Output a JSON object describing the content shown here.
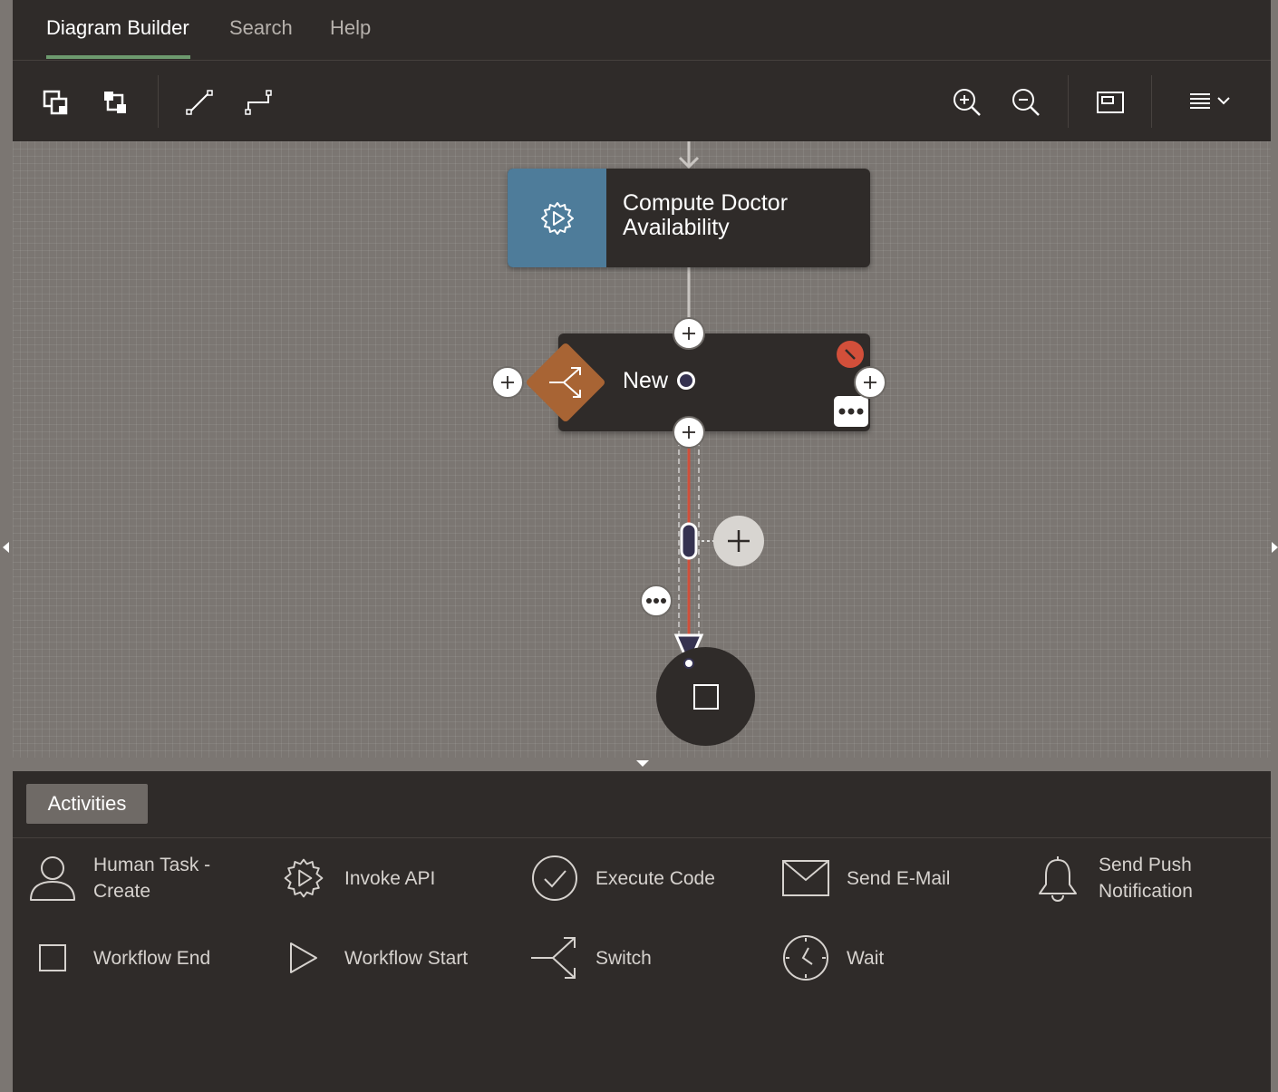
{
  "tabs": [
    {
      "label": "Diagram Builder",
      "active": true
    },
    {
      "label": "Search",
      "active": false
    },
    {
      "label": "Help",
      "active": false
    }
  ],
  "toolbar": {
    "left_icons": [
      "bring-to-front-icon",
      "send-to-back-icon",
      "straight-connector-icon",
      "elbow-connector-icon"
    ],
    "right_icons": [
      "zoom-in-icon",
      "zoom-out-icon",
      "fit-to-window-icon",
      "menu-icon"
    ]
  },
  "diagram": {
    "node1": {
      "label": "Compute Doctor Availability",
      "icon": "invoke-api-gear-icon",
      "color": "#4e7c9a"
    },
    "node2": {
      "label": "New",
      "icon": "switch-icon",
      "color": "#a86434",
      "status": "error"
    },
    "end_node": {
      "icon": "workflow-end-icon"
    },
    "connector_color": "#d24f3a"
  },
  "palette": {
    "tab_label": "Activities",
    "items": [
      {
        "label": "Human Task -\nCreate",
        "icon": "person-icon"
      },
      {
        "label": "Invoke API",
        "icon": "gear-play-icon"
      },
      {
        "label": "Execute Code",
        "icon": "check-circle-icon"
      },
      {
        "label": "Send E-Mail",
        "icon": "envelope-icon"
      },
      {
        "label": "Send Push\nNotification",
        "icon": "bell-icon"
      },
      {
        "label": "Workflow End",
        "icon": "square-icon"
      },
      {
        "label": "Workflow Start",
        "icon": "play-icon"
      },
      {
        "label": "Switch",
        "icon": "switch-icon"
      },
      {
        "label": "Wait",
        "icon": "clock-icon"
      }
    ]
  }
}
